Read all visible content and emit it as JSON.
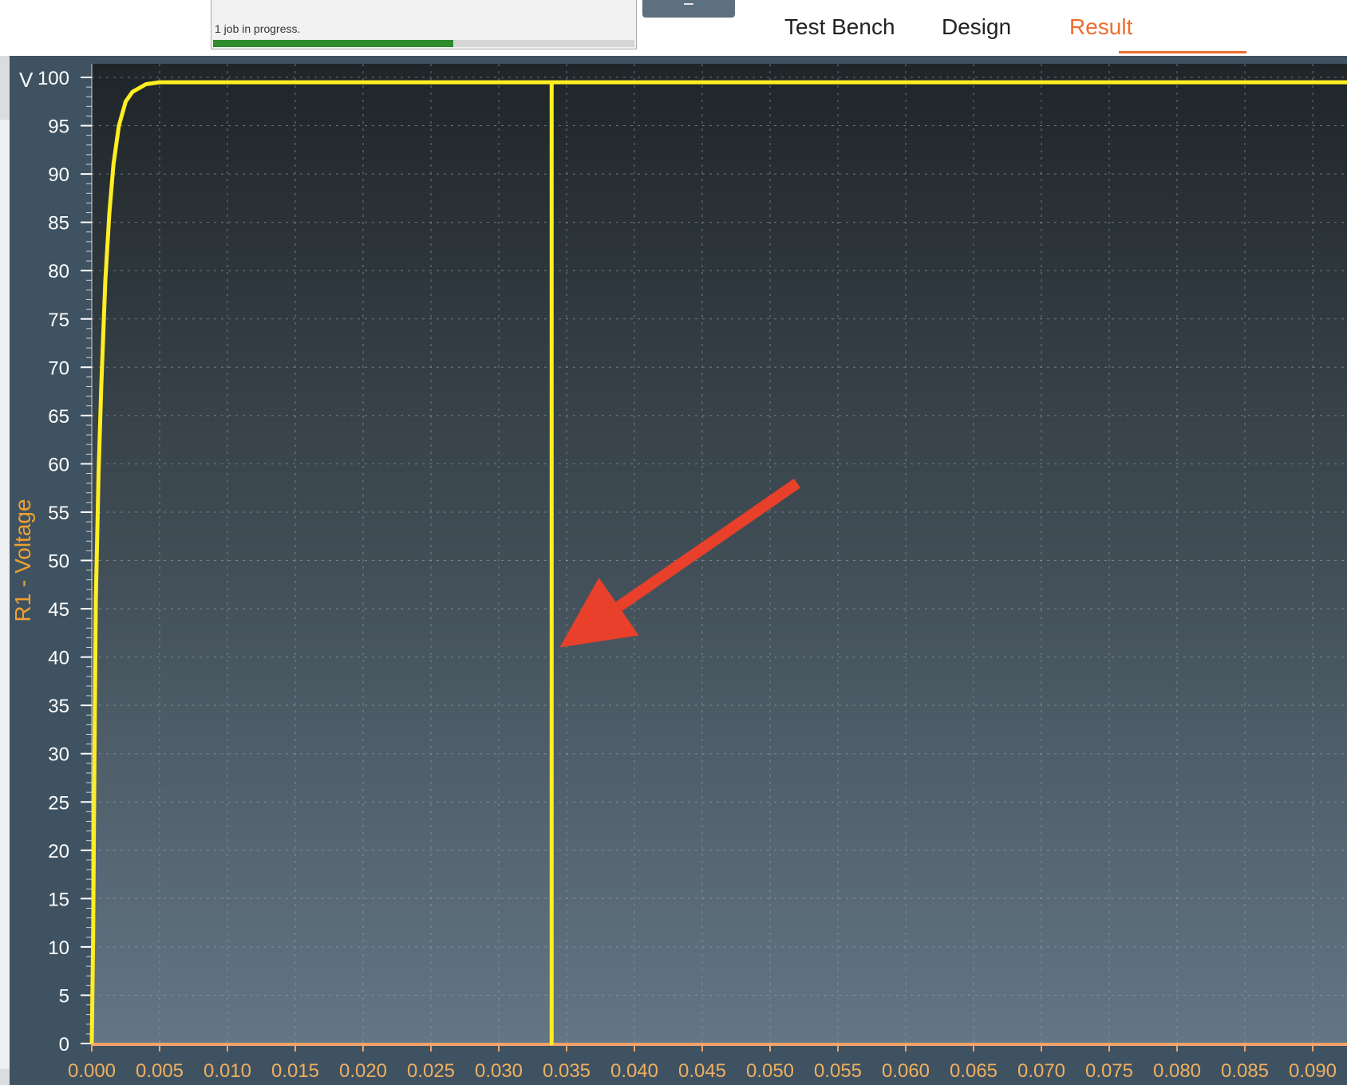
{
  "status": {
    "job_text": "1 job in progress.",
    "progress_fraction": 0.57
  },
  "tabs": [
    {
      "label": "Test Bench",
      "active": false
    },
    {
      "label": "Design",
      "active": false
    },
    {
      "label": "Result",
      "active": true
    }
  ],
  "colors": {
    "accent": "#ef6c2d",
    "trace": "#ffee22",
    "annotation_arrow": "#e8402a",
    "progress": "#2e8b2e"
  },
  "chart_data": {
    "type": "line",
    "ylabel": "R1 - Voltage",
    "yunit": "V",
    "ylim": [
      0,
      100
    ],
    "yticks": [
      0,
      5,
      10,
      15,
      20,
      25,
      30,
      35,
      40,
      45,
      50,
      55,
      60,
      65,
      70,
      75,
      80,
      85,
      90,
      95,
      100
    ],
    "xlim": [
      0,
      0.093
    ],
    "xticks": [
      "0.000",
      "0.005",
      "0.010",
      "0.015",
      "0.020",
      "0.025",
      "0.030",
      "0.035",
      "0.040",
      "0.045",
      "0.050",
      "0.055",
      "0.060",
      "0.065",
      "0.070",
      "0.075",
      "0.080",
      "0.085",
      "0.090"
    ],
    "grid": true,
    "series": [
      {
        "color": "#ffee22",
        "x": [
          0,
          0.0001,
          0.0002,
          0.0003,
          0.0005,
          0.0007,
          0.001,
          0.0013,
          0.0016,
          0.002,
          0.0025,
          0.003,
          0.004,
          0.005,
          0.0339,
          0.0339,
          0.0339,
          0.093
        ],
        "y": [
          0,
          11,
          30,
          46,
          59,
          68,
          79,
          86,
          91,
          95,
          97.5,
          98.5,
          99.3,
          99.5,
          99.5,
          0,
          99.5,
          99.5
        ]
      }
    ],
    "annotations": [
      {
        "type": "arrow",
        "from": [
          0.052,
          58
        ],
        "to": [
          0.0345,
          41
        ],
        "color": "#e8402a"
      }
    ]
  }
}
